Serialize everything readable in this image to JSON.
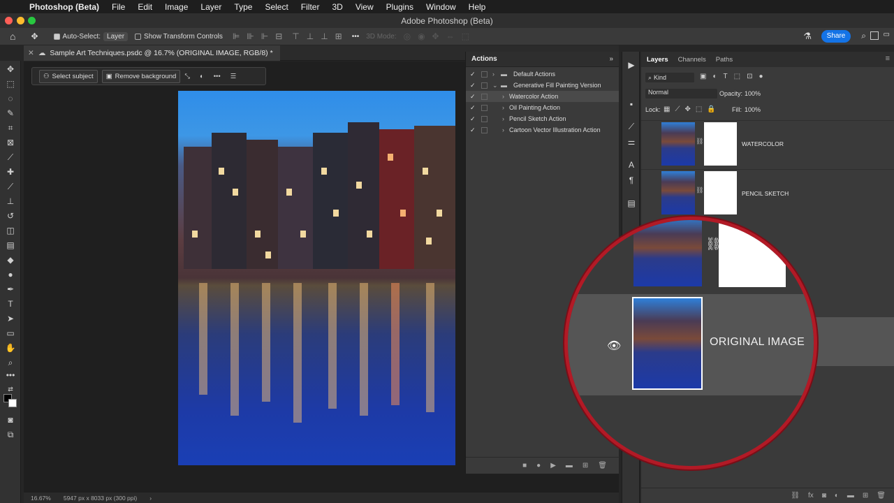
{
  "menubar": {
    "app": "Photoshop (Beta)",
    "items": [
      "File",
      "Edit",
      "Image",
      "Layer",
      "Type",
      "Select",
      "Filter",
      "3D",
      "View",
      "Plugins",
      "Window",
      "Help"
    ]
  },
  "window": {
    "title": "Adobe Photoshop (Beta)"
  },
  "options_bar": {
    "auto_select_label": "Auto-Select:",
    "auto_select_value": "Layer",
    "show_transform_label": "Show Transform Controls",
    "mode_3d_label": "3D Mode:",
    "share_label": "Share"
  },
  "document": {
    "tab_title": "Sample Art Techniques.psdc @ 16.7% (ORIGINAL IMAGE, RGB/8) *"
  },
  "context_bar": {
    "select_subject": "Select subject",
    "remove_background": "Remove background"
  },
  "actions_panel": {
    "title": "Actions",
    "rows": [
      {
        "label": "Default Actions",
        "kind": "set"
      },
      {
        "label": "Generative Fill Painting Version",
        "kind": "set-open"
      },
      {
        "label": "Watercolor Action",
        "kind": "action",
        "selected": true
      },
      {
        "label": "Oil Painting Action",
        "kind": "action"
      },
      {
        "label": "Pencil Sketch Action",
        "kind": "action"
      },
      {
        "label": "Cartoon Vector Illustration Action",
        "kind": "action"
      }
    ]
  },
  "layers_panel": {
    "tabs": [
      "Layers",
      "Channels",
      "Paths"
    ],
    "kind_label": "Kind",
    "blend_mode": "Normal",
    "opacity_label": "Opacity:",
    "opacity_value": "100%",
    "lock_label": "Lock:",
    "fill_label": "Fill:",
    "fill_value": "100%",
    "layers": [
      {
        "name": "WATERCOLOR"
      },
      {
        "name": "PENCIL SKETCH"
      },
      {
        "name": ""
      },
      {
        "name": "ORIGINAL IMAGE",
        "visible": true,
        "selected": true
      }
    ]
  },
  "status_bar": {
    "zoom": "16.67%",
    "doc_info": "5947 px x 8033 px (300 ppi)"
  },
  "colors": {
    "accent": "#1473e6",
    "highlight_ring": "#b21a26"
  }
}
